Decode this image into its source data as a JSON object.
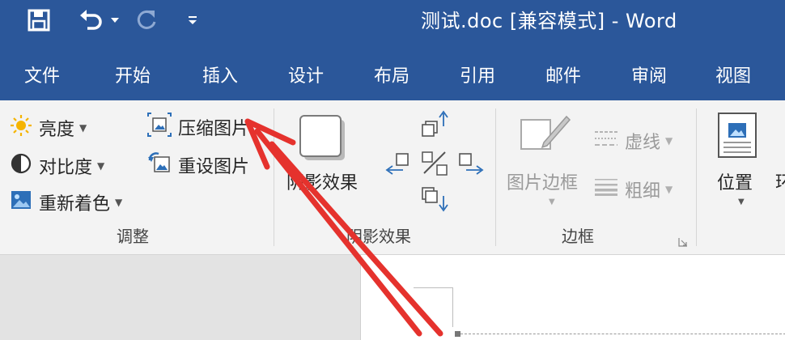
{
  "window": {
    "title": "测试.doc [兼容模式]  -  Word"
  },
  "quick_access": {
    "icons": [
      "save-icon",
      "undo-icon",
      "redo-icon",
      "customize-icon"
    ]
  },
  "menu": {
    "tabs": [
      "文件",
      "开始",
      "插入",
      "设计",
      "布局",
      "引用",
      "邮件",
      "审阅",
      "视图"
    ]
  },
  "ribbon": {
    "adjust": {
      "brightness": "亮度",
      "contrast": "对比度",
      "recolor": "重新着色",
      "compress": "压缩图片",
      "reset": "重设图片",
      "label": "调整"
    },
    "shadow": {
      "button": "阴影效果",
      "label": "阴影效果"
    },
    "border": {
      "picture_border": "图片边框",
      "dashes": "虚线",
      "weight": "粗细",
      "label": "边框"
    },
    "arrange": {
      "position": "位置"
    }
  },
  "colors": {
    "accent": "#2b579a",
    "annotation_arrow": "#e5322d"
  }
}
